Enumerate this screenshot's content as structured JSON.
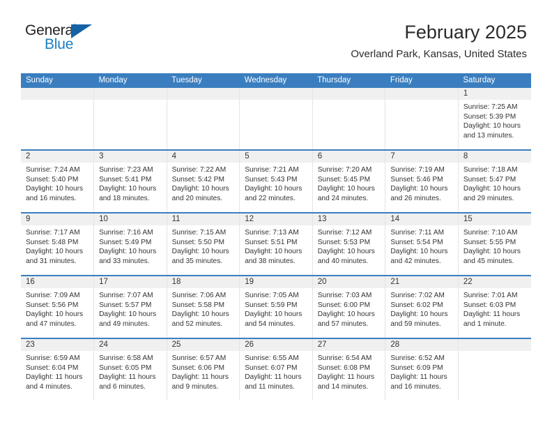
{
  "brand": {
    "name_top": "General",
    "name_bottom": "Blue",
    "accent_color": "#1462a6",
    "blue_text_color": "#1b7fc4"
  },
  "header": {
    "title": "February 2025",
    "subtitle": "Overland Park, Kansas, United States"
  },
  "theme": {
    "header_row_bg": "#3a7ebf",
    "header_row_text": "#ffffff",
    "daynum_band_bg": "#f0f0f0",
    "cell_divider": "#e4e4e4"
  },
  "columns": [
    "Sunday",
    "Monday",
    "Tuesday",
    "Wednesday",
    "Thursday",
    "Friday",
    "Saturday"
  ],
  "labels": {
    "sunrise_prefix": "Sunrise:",
    "sunset_prefix": "Sunset:",
    "daylight_prefix": "Daylight:"
  },
  "weeks": [
    [
      {
        "empty": true
      },
      {
        "empty": true
      },
      {
        "empty": true
      },
      {
        "empty": true
      },
      {
        "empty": true
      },
      {
        "empty": true
      },
      {
        "day": "1",
        "sunrise": "Sunrise: 7:25 AM",
        "sunset": "Sunset: 5:39 PM",
        "daylight1": "Daylight: 10 hours",
        "daylight2": "and 13 minutes."
      }
    ],
    [
      {
        "day": "2",
        "sunrise": "Sunrise: 7:24 AM",
        "sunset": "Sunset: 5:40 PM",
        "daylight1": "Daylight: 10 hours",
        "daylight2": "and 16 minutes."
      },
      {
        "day": "3",
        "sunrise": "Sunrise: 7:23 AM",
        "sunset": "Sunset: 5:41 PM",
        "daylight1": "Daylight: 10 hours",
        "daylight2": "and 18 minutes."
      },
      {
        "day": "4",
        "sunrise": "Sunrise: 7:22 AM",
        "sunset": "Sunset: 5:42 PM",
        "daylight1": "Daylight: 10 hours",
        "daylight2": "and 20 minutes."
      },
      {
        "day": "5",
        "sunrise": "Sunrise: 7:21 AM",
        "sunset": "Sunset: 5:43 PM",
        "daylight1": "Daylight: 10 hours",
        "daylight2": "and 22 minutes."
      },
      {
        "day": "6",
        "sunrise": "Sunrise: 7:20 AM",
        "sunset": "Sunset: 5:45 PM",
        "daylight1": "Daylight: 10 hours",
        "daylight2": "and 24 minutes."
      },
      {
        "day": "7",
        "sunrise": "Sunrise: 7:19 AM",
        "sunset": "Sunset: 5:46 PM",
        "daylight1": "Daylight: 10 hours",
        "daylight2": "and 26 minutes."
      },
      {
        "day": "8",
        "sunrise": "Sunrise: 7:18 AM",
        "sunset": "Sunset: 5:47 PM",
        "daylight1": "Daylight: 10 hours",
        "daylight2": "and 29 minutes."
      }
    ],
    [
      {
        "day": "9",
        "sunrise": "Sunrise: 7:17 AM",
        "sunset": "Sunset: 5:48 PM",
        "daylight1": "Daylight: 10 hours",
        "daylight2": "and 31 minutes."
      },
      {
        "day": "10",
        "sunrise": "Sunrise: 7:16 AM",
        "sunset": "Sunset: 5:49 PM",
        "daylight1": "Daylight: 10 hours",
        "daylight2": "and 33 minutes."
      },
      {
        "day": "11",
        "sunrise": "Sunrise: 7:15 AM",
        "sunset": "Sunset: 5:50 PM",
        "daylight1": "Daylight: 10 hours",
        "daylight2": "and 35 minutes."
      },
      {
        "day": "12",
        "sunrise": "Sunrise: 7:13 AM",
        "sunset": "Sunset: 5:51 PM",
        "daylight1": "Daylight: 10 hours",
        "daylight2": "and 38 minutes."
      },
      {
        "day": "13",
        "sunrise": "Sunrise: 7:12 AM",
        "sunset": "Sunset: 5:53 PM",
        "daylight1": "Daylight: 10 hours",
        "daylight2": "and 40 minutes."
      },
      {
        "day": "14",
        "sunrise": "Sunrise: 7:11 AM",
        "sunset": "Sunset: 5:54 PM",
        "daylight1": "Daylight: 10 hours",
        "daylight2": "and 42 minutes."
      },
      {
        "day": "15",
        "sunrise": "Sunrise: 7:10 AM",
        "sunset": "Sunset: 5:55 PM",
        "daylight1": "Daylight: 10 hours",
        "daylight2": "and 45 minutes."
      }
    ],
    [
      {
        "day": "16",
        "sunrise": "Sunrise: 7:09 AM",
        "sunset": "Sunset: 5:56 PM",
        "daylight1": "Daylight: 10 hours",
        "daylight2": "and 47 minutes."
      },
      {
        "day": "17",
        "sunrise": "Sunrise: 7:07 AM",
        "sunset": "Sunset: 5:57 PM",
        "daylight1": "Daylight: 10 hours",
        "daylight2": "and 49 minutes."
      },
      {
        "day": "18",
        "sunrise": "Sunrise: 7:06 AM",
        "sunset": "Sunset: 5:58 PM",
        "daylight1": "Daylight: 10 hours",
        "daylight2": "and 52 minutes."
      },
      {
        "day": "19",
        "sunrise": "Sunrise: 7:05 AM",
        "sunset": "Sunset: 5:59 PM",
        "daylight1": "Daylight: 10 hours",
        "daylight2": "and 54 minutes."
      },
      {
        "day": "20",
        "sunrise": "Sunrise: 7:03 AM",
        "sunset": "Sunset: 6:00 PM",
        "daylight1": "Daylight: 10 hours",
        "daylight2": "and 57 minutes."
      },
      {
        "day": "21",
        "sunrise": "Sunrise: 7:02 AM",
        "sunset": "Sunset: 6:02 PM",
        "daylight1": "Daylight: 10 hours",
        "daylight2": "and 59 minutes."
      },
      {
        "day": "22",
        "sunrise": "Sunrise: 7:01 AM",
        "sunset": "Sunset: 6:03 PM",
        "daylight1": "Daylight: 11 hours",
        "daylight2": "and 1 minute."
      }
    ],
    [
      {
        "day": "23",
        "sunrise": "Sunrise: 6:59 AM",
        "sunset": "Sunset: 6:04 PM",
        "daylight1": "Daylight: 11 hours",
        "daylight2": "and 4 minutes."
      },
      {
        "day": "24",
        "sunrise": "Sunrise: 6:58 AM",
        "sunset": "Sunset: 6:05 PM",
        "daylight1": "Daylight: 11 hours",
        "daylight2": "and 6 minutes."
      },
      {
        "day": "25",
        "sunrise": "Sunrise: 6:57 AM",
        "sunset": "Sunset: 6:06 PM",
        "daylight1": "Daylight: 11 hours",
        "daylight2": "and 9 minutes."
      },
      {
        "day": "26",
        "sunrise": "Sunrise: 6:55 AM",
        "sunset": "Sunset: 6:07 PM",
        "daylight1": "Daylight: 11 hours",
        "daylight2": "and 11 minutes."
      },
      {
        "day": "27",
        "sunrise": "Sunrise: 6:54 AM",
        "sunset": "Sunset: 6:08 PM",
        "daylight1": "Daylight: 11 hours",
        "daylight2": "and 14 minutes."
      },
      {
        "day": "28",
        "sunrise": "Sunrise: 6:52 AM",
        "sunset": "Sunset: 6:09 PM",
        "daylight1": "Daylight: 11 hours",
        "daylight2": "and 16 minutes."
      },
      {
        "empty": true
      }
    ]
  ]
}
